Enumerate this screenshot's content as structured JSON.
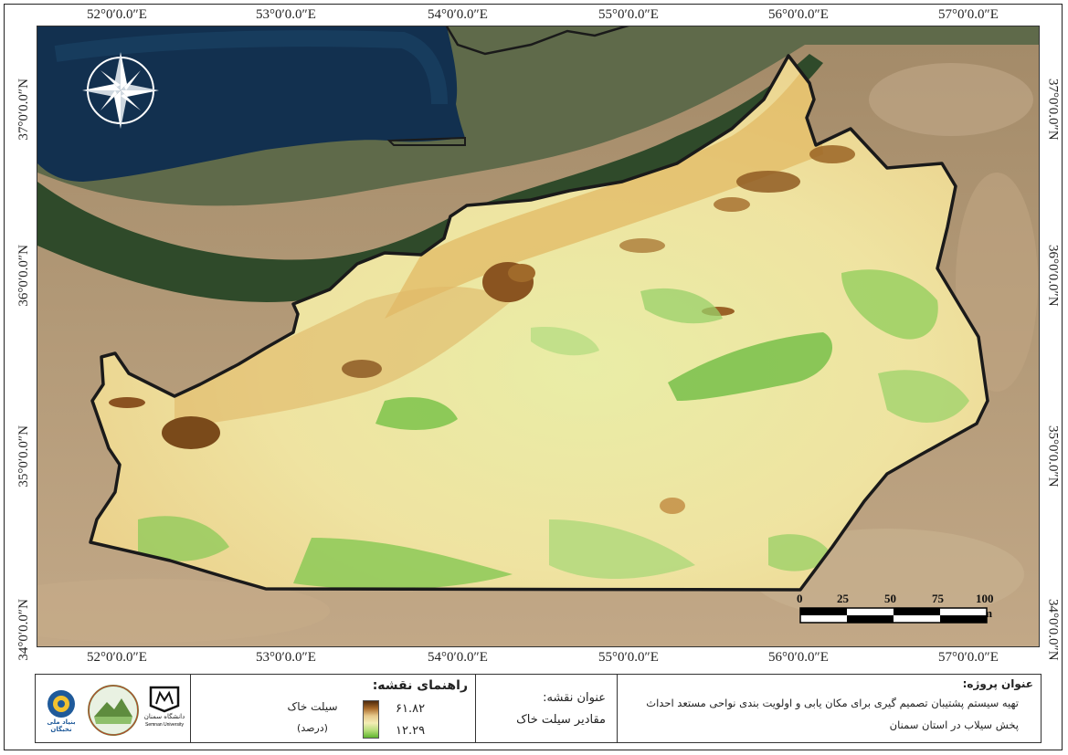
{
  "map": {
    "longitude_labels": [
      "52°0′0.0″E",
      "53°0′0.0″E",
      "54°0′0.0″E",
      "55°0′0.0″E",
      "56°0′0.0″E",
      "57°0′0.0″E"
    ],
    "latitude_labels": [
      "37°0′0.0″N",
      "36°0′0.0″N",
      "35°0′0.0″N",
      "34°0′0.0″N"
    ],
    "north_arrow_icon": "compass-rose-icon",
    "scale": {
      "ticks": [
        "0",
        "25",
        "50",
        "75",
        "100 km"
      ]
    }
  },
  "legend": {
    "title": "راهنمای نقشه:",
    "layer_name": "سیلت خاک",
    "unit": "(درصد)",
    "max_value": "۶۱.۸۲",
    "min_value": "۱۲.۲۹",
    "ramp_colors": [
      "#4e2a0c",
      "#a86a2a",
      "#e6c88a",
      "#f3edb5",
      "#b6de7a",
      "#5fb52f"
    ]
  },
  "map_title": {
    "label": "عنوان نقشه:",
    "value": "مقادیر سیلت خاک"
  },
  "project": {
    "label": "عنوان پروژه:",
    "line1": "تهیه سیستم پشتیبان تصمیم گیری برای مکان یابی و اولویت بندی نواحی مستعد احداث",
    "line2": "پخش سیلاب در استان سمنان"
  },
  "logos": {
    "logo1_text": "بنیاد ملی نخبگان",
    "logo3_text": "دانشگاه سمنان",
    "logo3_subtext": "Semnan University"
  }
}
